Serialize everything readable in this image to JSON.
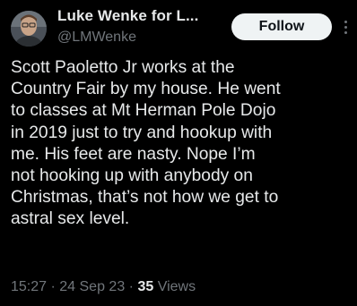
{
  "author": {
    "display_name": "Luke Wenke for L...",
    "handle": "@LMWenke",
    "avatar_icon": "user-avatar-photo"
  },
  "actions": {
    "follow_label": "Follow",
    "more_icon": "more-vertical-icon"
  },
  "tweet": {
    "text": "Scott Paoletto Jr works at the\nCountry Fair by my house.  He went\nto classes at Mt Herman Pole Dojo\nin 2019 just to try and hookup with\nme.  His feet are nasty.  Nope I’m\nnot hooking up with anybody on\nChristmas, that’s not how we get to\nastral sex level.",
    "time": "15:27",
    "date": "24 Sep 23",
    "separator": " · ",
    "views_count": "35",
    "views_label": "Views"
  },
  "colors": {
    "background": "#000000",
    "primary_text": "#e7e9ea",
    "secondary_text": "#71767b",
    "follow_bg": "#eff3f4"
  }
}
